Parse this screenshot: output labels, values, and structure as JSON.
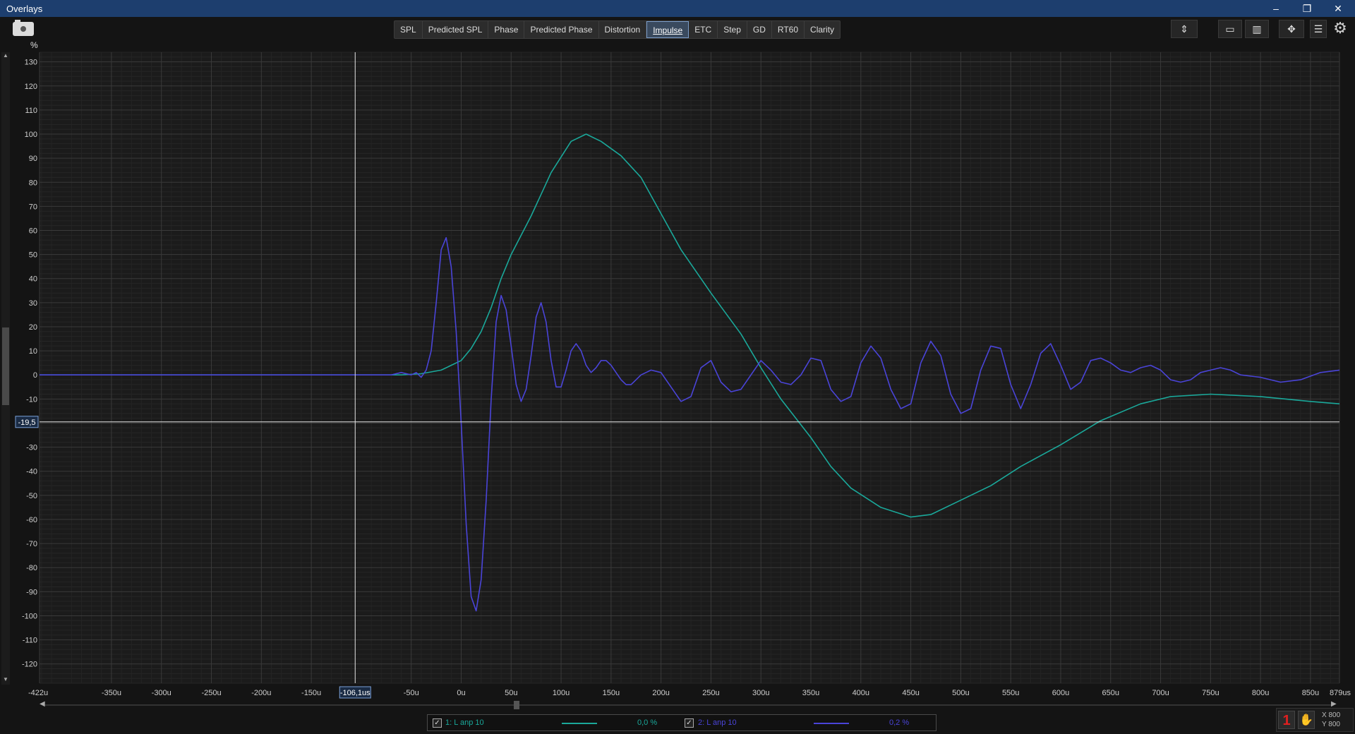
{
  "window": {
    "title": "Overlays",
    "minimize": "–",
    "restore": "❐",
    "close": "✕"
  },
  "toolbar": {
    "tabs": [
      "SPL",
      "Predicted SPL",
      "Phase",
      "Predicted Phase",
      "Distortion",
      "Impulse",
      "ETC",
      "Step",
      "GD",
      "RT60",
      "Clarity"
    ],
    "active_tab": "Impulse",
    "y_unit": "%"
  },
  "cursor": {
    "x_label": "-106,1us",
    "y_label": "-19,5",
    "x_value": -106.1,
    "y_value": -19.5
  },
  "chart_data": {
    "type": "line",
    "xlim": [
      -422,
      879
    ],
    "ylim": [
      -128,
      134
    ],
    "x_ticks": [
      {
        "v": -422,
        "label": "-422u"
      },
      {
        "v": -350,
        "label": "-350u"
      },
      {
        "v": -300,
        "label": "-300u"
      },
      {
        "v": -250,
        "label": "-250u"
      },
      {
        "v": -200,
        "label": "-200u"
      },
      {
        "v": -150,
        "label": "-150u"
      },
      {
        "v": -50,
        "label": "-50u"
      },
      {
        "v": 0,
        "label": "0u"
      },
      {
        "v": 50,
        "label": "50u"
      },
      {
        "v": 100,
        "label": "100u"
      },
      {
        "v": 150,
        "label": "150u"
      },
      {
        "v": 200,
        "label": "200u"
      },
      {
        "v": 250,
        "label": "250u"
      },
      {
        "v": 300,
        "label": "300u"
      },
      {
        "v": 350,
        "label": "350u"
      },
      {
        "v": 400,
        "label": "400u"
      },
      {
        "v": 450,
        "label": "450u"
      },
      {
        "v": 500,
        "label": "500u"
      },
      {
        "v": 550,
        "label": "550u"
      },
      {
        "v": 600,
        "label": "600u"
      },
      {
        "v": 650,
        "label": "650u"
      },
      {
        "v": 700,
        "label": "700u"
      },
      {
        "v": 750,
        "label": "750u"
      },
      {
        "v": 800,
        "label": "800u"
      },
      {
        "v": 850,
        "label": "850u"
      },
      {
        "v": 879,
        "label": "879us"
      }
    ],
    "y_ticks": [
      130,
      120,
      110,
      100,
      90,
      80,
      70,
      60,
      50,
      40,
      30,
      20,
      10,
      0,
      -10,
      -20,
      -30,
      -40,
      -50,
      -60,
      -70,
      -80,
      -90,
      -100,
      -110,
      -120
    ],
    "grid": true,
    "series": [
      {
        "name": "1: L anp 10",
        "value": "0,0 %",
        "color": "#1aa89a",
        "x": [
          -422,
          -200,
          -100,
          -60,
          -40,
          -20,
          0,
          10,
          20,
          30,
          40,
          50,
          70,
          90,
          110,
          125,
          140,
          160,
          180,
          200,
          220,
          250,
          280,
          300,
          320,
          350,
          370,
          390,
          420,
          450,
          470,
          500,
          530,
          560,
          600,
          640,
          680,
          710,
          750,
          800,
          850,
          879
        ],
        "y": [
          0,
          0,
          0,
          0,
          0.5,
          2,
          6,
          11,
          18,
          28,
          40,
          50,
          66,
          84,
          97,
          100,
          97,
          91,
          82,
          67,
          52,
          34,
          17,
          3,
          -10,
          -26,
          -38,
          -47,
          -55,
          -59,
          -58,
          -52,
          -46,
          -38,
          -29,
          -19,
          -12,
          -9,
          -8,
          -9,
          -11,
          -12
        ]
      },
      {
        "name": "2: L anp 10",
        "value": "0,2 %",
        "color": "#4a44d8",
        "x": [
          -422,
          -300,
          -200,
          -150,
          -100,
          -70,
          -60,
          -50,
          -45,
          -40,
          -35,
          -30,
          -25,
          -20,
          -15,
          -10,
          -5,
          0,
          5,
          10,
          15,
          20,
          25,
          30,
          35,
          40,
          45,
          50,
          55,
          60,
          65,
          70,
          75,
          80,
          85,
          90,
          95,
          100,
          105,
          110,
          115,
          120,
          125,
          130,
          135,
          140,
          145,
          150,
          155,
          160,
          165,
          170,
          175,
          180,
          185,
          190,
          200,
          210,
          220,
          230,
          240,
          250,
          260,
          270,
          280,
          290,
          300,
          310,
          320,
          330,
          340,
          350,
          360,
          370,
          380,
          390,
          400,
          410,
          420,
          430,
          440,
          450,
          460,
          470,
          480,
          490,
          500,
          510,
          520,
          530,
          540,
          550,
          560,
          570,
          580,
          590,
          600,
          610,
          620,
          630,
          640,
          650,
          660,
          670,
          680,
          690,
          700,
          710,
          720,
          730,
          740,
          750,
          760,
          770,
          780,
          800,
          820,
          840,
          860,
          879
        ],
        "y": [
          0,
          0,
          0,
          0,
          0,
          0,
          1,
          0,
          1,
          -1,
          2,
          10,
          30,
          52,
          57,
          45,
          18,
          -20,
          -62,
          -92,
          -98,
          -85,
          -52,
          -10,
          22,
          33,
          27,
          12,
          -4,
          -11,
          -6,
          8,
          24,
          30,
          22,
          6,
          -5,
          -5,
          2,
          10,
          13,
          10,
          4,
          1,
          3,
          6,
          6,
          4,
          1,
          -2,
          -4,
          -4,
          -2,
          0,
          1,
          2,
          1,
          -5,
          -11,
          -9,
          3,
          6,
          -3,
          -7,
          -6,
          0,
          6,
          2,
          -3,
          -4,
          0,
          7,
          6,
          -6,
          -11,
          -9,
          5,
          12,
          7,
          -6,
          -14,
          -12,
          5,
          14,
          8,
          -8,
          -16,
          -14,
          2,
          12,
          11,
          -4,
          -14,
          -4,
          9,
          13,
          4,
          -6,
          -3,
          6,
          7,
          5,
          2,
          1,
          3,
          4,
          2,
          -2,
          -3,
          -2,
          1,
          2,
          3,
          2,
          0,
          -1,
          -3,
          -2,
          1,
          2
        ]
      }
    ]
  },
  "legend": [
    {
      "checked": "✓",
      "name": "1: L anp 10",
      "value": "0,0 %",
      "color": "#1aa89a"
    },
    {
      "checked": "✓",
      "name": "2: L anp 10",
      "value": "0,2 %",
      "color": "#4a44d8"
    }
  ],
  "status": {
    "x_scale": "X 800",
    "y_scale": "Y 800",
    "badge": "1"
  }
}
